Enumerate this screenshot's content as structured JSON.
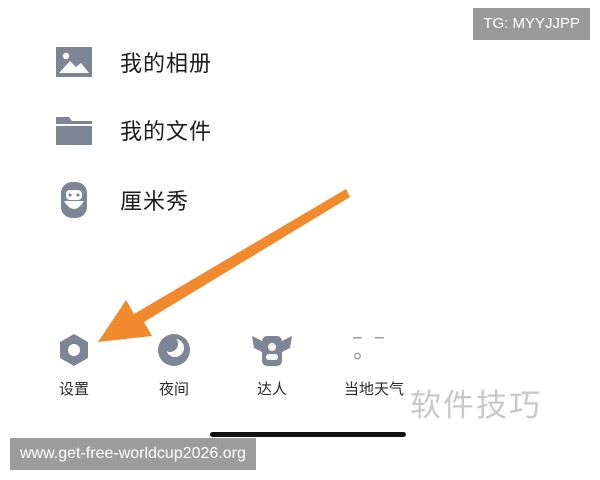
{
  "watermark_top": "TG: MYYJJPP",
  "menu": {
    "items": [
      {
        "label": "我的相册",
        "icon": "photo-album-icon"
      },
      {
        "label": "我的文件",
        "icon": "folder-icon"
      },
      {
        "label": "厘米秀",
        "icon": "avatar-face-icon"
      }
    ]
  },
  "bottom_bar": {
    "buttons": [
      {
        "label": "设置",
        "icon": "settings-gear-icon"
      },
      {
        "label": "夜间",
        "icon": "night-moon-icon"
      },
      {
        "label": "达人",
        "icon": "expert-badge-icon"
      },
      {
        "label": "当地天气",
        "value": "– –°",
        "icon": "weather-icon"
      }
    ]
  },
  "watermark_corner": "软件技巧",
  "watermark_bottom": "www.get-free-worldcup2026.org",
  "colors": {
    "icon_fill": "#7d8596",
    "arrow": "#f08a2c",
    "background": "#ffffff"
  }
}
